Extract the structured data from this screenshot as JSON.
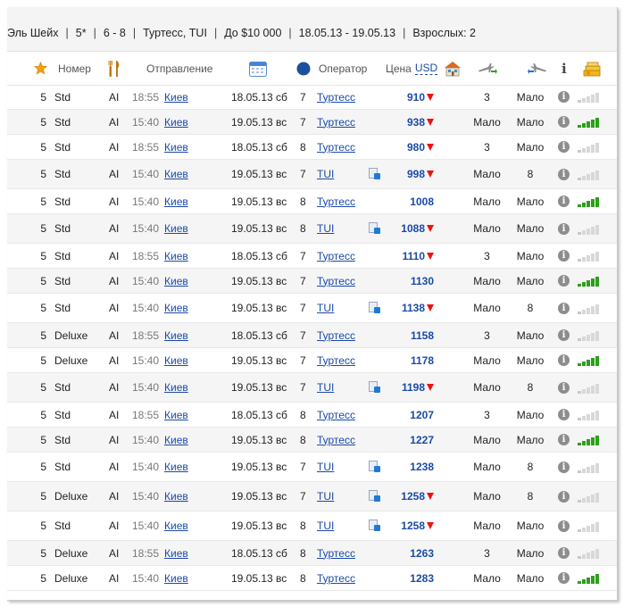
{
  "filters": {
    "destination": "Эль Шейх",
    "stars": "5*",
    "nights": "6 - 8",
    "operators": "Туртесс, TUI",
    "budget": "До $10 000",
    "dates": "18.05.13 - 19.05.13",
    "adults": "Взрослых: 2"
  },
  "header": {
    "room": "Номер",
    "departure": "Отправление",
    "operator": "Оператор",
    "price": "Цена",
    "currency": "USD",
    "info": "i"
  },
  "colors": {
    "link": "#1a4aa8",
    "price_down": "#e11111",
    "bar_active": "#2e9e1c"
  },
  "rows": [
    {
      "stars": "5",
      "room": "Std",
      "meal": "AI",
      "time": "18:55",
      "city": "Киев",
      "date": "18.05.13 сб",
      "nights": "7",
      "operator": "Туртесс",
      "doc": false,
      "price": "910",
      "down": true,
      "out": "3",
      "back": "Мало",
      "bars": "empty"
    },
    {
      "stars": "5",
      "room": "Std",
      "meal": "AI",
      "time": "15:40",
      "city": "Киев",
      "date": "19.05.13 вс",
      "nights": "7",
      "operator": "Туртесс",
      "doc": false,
      "price": "938",
      "down": true,
      "out": "Мало",
      "back": "Мало",
      "bars": "full"
    },
    {
      "stars": "5",
      "room": "Std",
      "meal": "AI",
      "time": "18:55",
      "city": "Киев",
      "date": "18.05.13 сб",
      "nights": "8",
      "operator": "Туртесс",
      "doc": false,
      "price": "980",
      "down": true,
      "out": "3",
      "back": "Мало",
      "bars": "empty"
    },
    {
      "stars": "5",
      "room": "Std",
      "meal": "AI",
      "time": "15:40",
      "city": "Киев",
      "date": "19.05.13 вс",
      "nights": "7",
      "operator": "TUI",
      "doc": true,
      "price": "998",
      "down": true,
      "out": "Мало",
      "back": "8",
      "bars": "empty"
    },
    {
      "stars": "5",
      "room": "Std",
      "meal": "AI",
      "time": "15:40",
      "city": "Киев",
      "date": "19.05.13 вс",
      "nights": "8",
      "operator": "Туртесс",
      "doc": false,
      "price": "1008",
      "down": false,
      "out": "Мало",
      "back": "Мало",
      "bars": "full"
    },
    {
      "stars": "5",
      "room": "Std",
      "meal": "AI",
      "time": "15:40",
      "city": "Киев",
      "date": "19.05.13 вс",
      "nights": "8",
      "operator": "TUI",
      "doc": true,
      "price": "1088",
      "down": true,
      "out": "Мало",
      "back": "Мало",
      "bars": "empty"
    },
    {
      "stars": "5",
      "room": "Std",
      "meal": "AI",
      "time": "18:55",
      "city": "Киев",
      "date": "18.05.13 сб",
      "nights": "7",
      "operator": "Туртесс",
      "doc": false,
      "price": "1110",
      "down": true,
      "out": "3",
      "back": "Мало",
      "bars": "empty"
    },
    {
      "stars": "5",
      "room": "Std",
      "meal": "AI",
      "time": "15:40",
      "city": "Киев",
      "date": "19.05.13 вс",
      "nights": "7",
      "operator": "Туртесс",
      "doc": false,
      "price": "1130",
      "down": false,
      "out": "Мало",
      "back": "Мало",
      "bars": "full"
    },
    {
      "stars": "5",
      "room": "Std",
      "meal": "AI",
      "time": "15:40",
      "city": "Киев",
      "date": "19.05.13 вс",
      "nights": "7",
      "operator": "TUI",
      "doc": true,
      "price": "1138",
      "down": true,
      "out": "Мало",
      "back": "8",
      "bars": "empty"
    },
    {
      "stars": "5",
      "room": "Deluxe",
      "meal": "AI",
      "time": "18:55",
      "city": "Киев",
      "date": "18.05.13 сб",
      "nights": "7",
      "operator": "Туртесс",
      "doc": false,
      "price": "1158",
      "down": false,
      "out": "3",
      "back": "Мало",
      "bars": "empty"
    },
    {
      "stars": "5",
      "room": "Deluxe",
      "meal": "AI",
      "time": "15:40",
      "city": "Киев",
      "date": "19.05.13 вс",
      "nights": "7",
      "operator": "Туртесс",
      "doc": false,
      "price": "1178",
      "down": false,
      "out": "Мало",
      "back": "Мало",
      "bars": "full"
    },
    {
      "stars": "5",
      "room": "Std",
      "meal": "AI",
      "time": "15:40",
      "city": "Киев",
      "date": "19.05.13 вс",
      "nights": "7",
      "operator": "TUI",
      "doc": true,
      "price": "1198",
      "down": true,
      "out": "Мало",
      "back": "8",
      "bars": "empty"
    },
    {
      "stars": "5",
      "room": "Std",
      "meal": "AI",
      "time": "18:55",
      "city": "Киев",
      "date": "18.05.13 сб",
      "nights": "8",
      "operator": "Туртесс",
      "doc": false,
      "price": "1207",
      "down": false,
      "out": "3",
      "back": "Мало",
      "bars": "empty"
    },
    {
      "stars": "5",
      "room": "Std",
      "meal": "AI",
      "time": "15:40",
      "city": "Киев",
      "date": "19.05.13 вс",
      "nights": "8",
      "operator": "Туртесс",
      "doc": false,
      "price": "1227",
      "down": false,
      "out": "Мало",
      "back": "Мало",
      "bars": "full"
    },
    {
      "stars": "5",
      "room": "Std",
      "meal": "AI",
      "time": "15:40",
      "city": "Киев",
      "date": "19.05.13 вс",
      "nights": "7",
      "operator": "TUI",
      "doc": true,
      "price": "1238",
      "down": false,
      "out": "Мало",
      "back": "8",
      "bars": "empty"
    },
    {
      "stars": "5",
      "room": "Deluxe",
      "meal": "AI",
      "time": "15:40",
      "city": "Киев",
      "date": "19.05.13 вс",
      "nights": "7",
      "operator": "TUI",
      "doc": true,
      "price": "1258",
      "down": true,
      "out": "Мало",
      "back": "8",
      "bars": "empty"
    },
    {
      "stars": "5",
      "room": "Std",
      "meal": "AI",
      "time": "15:40",
      "city": "Киев",
      "date": "19.05.13 вс",
      "nights": "8",
      "operator": "TUI",
      "doc": true,
      "price": "1258",
      "down": true,
      "out": "Мало",
      "back": "Мало",
      "bars": "empty"
    },
    {
      "stars": "5",
      "room": "Deluxe",
      "meal": "AI",
      "time": "18:55",
      "city": "Киев",
      "date": "18.05.13 сб",
      "nights": "8",
      "operator": "Туртесс",
      "doc": false,
      "price": "1263",
      "down": false,
      "out": "3",
      "back": "Мало",
      "bars": "empty"
    },
    {
      "stars": "5",
      "room": "Deluxe",
      "meal": "AI",
      "time": "15:40",
      "city": "Киев",
      "date": "19.05.13 вс",
      "nights": "8",
      "operator": "Туртесс",
      "doc": false,
      "price": "1283",
      "down": false,
      "out": "Мало",
      "back": "Мало",
      "bars": "full"
    }
  ]
}
